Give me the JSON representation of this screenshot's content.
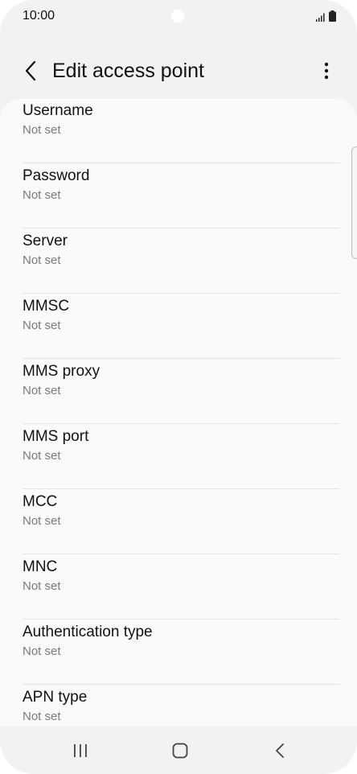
{
  "status_bar": {
    "time": "10:00",
    "icons": [
      "signal-icon",
      "battery-icon"
    ]
  },
  "header": {
    "title": "Edit access point",
    "back_icon": "chevron-left-icon",
    "more_icon": "more-vertical-icon"
  },
  "settings": {
    "items": [
      {
        "label": "Username",
        "value": "Not set"
      },
      {
        "label": "Password",
        "value": "Not set"
      },
      {
        "label": "Server",
        "value": "Not set"
      },
      {
        "label": "MMSC",
        "value": "Not set"
      },
      {
        "label": "MMS proxy",
        "value": "Not set"
      },
      {
        "label": "MMS port",
        "value": "Not set"
      },
      {
        "label": "MCC",
        "value": "Not set"
      },
      {
        "label": "MNC",
        "value": "Not set"
      },
      {
        "label": "Authentication type",
        "value": "Not set"
      },
      {
        "label": "APN type",
        "value": "Not set"
      }
    ]
  },
  "nav_bar": {
    "icons": [
      "recent-apps-icon",
      "home-icon",
      "back-icon"
    ]
  },
  "colors": {
    "background": "#f2f2f2",
    "card": "#fafafa",
    "primary_text": "#111111",
    "secondary_text": "#7a7a7a",
    "divider": "#e3e3e3"
  }
}
